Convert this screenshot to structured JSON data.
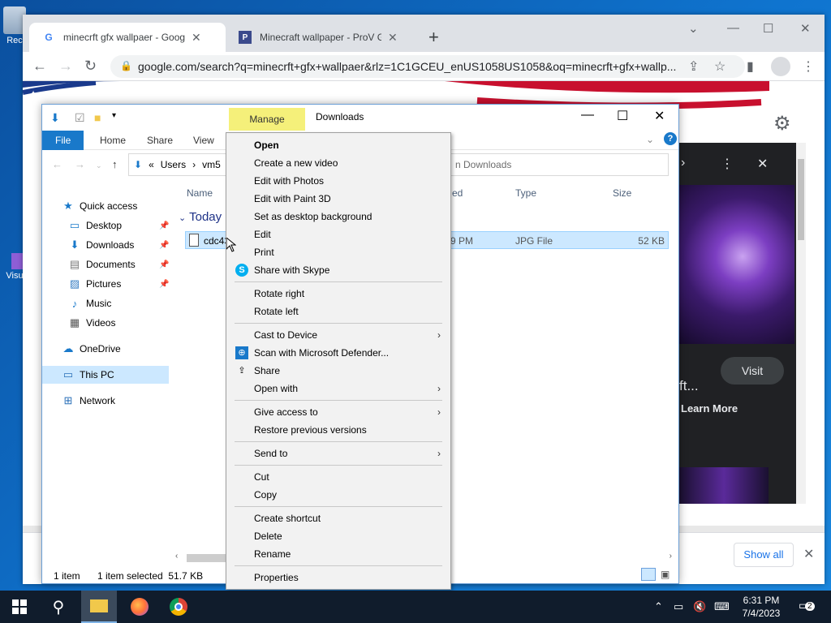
{
  "desktop": {
    "icon1_label": "Rec",
    "icon2_label": "Visu"
  },
  "chrome": {
    "tabs": [
      {
        "title": "minecrft gfx wallpaer - Google Se",
        "favicon": "G"
      },
      {
        "title": "Minecraft wallpaper - ProV GFX -",
        "favicon": "P"
      }
    ],
    "url": "google.com/search?q=minecrft+gfx+wallpaer&rlz=1C1GCEU_enUS1058US1058&oq=minecrft+gfx+wallp...",
    "panel": {
      "title_fragment": "ft...",
      "visit": "Visit",
      "learn_more": "Learn More"
    },
    "download_bar": {
      "show_all": "Show all"
    }
  },
  "explorer": {
    "manage_tab": "Manage",
    "title": "Downloads",
    "ribbon": [
      "File",
      "Home",
      "Share",
      "View"
    ],
    "address": {
      "chevron": "«",
      "segments": [
        "Users",
        "vm5"
      ]
    },
    "search_placeholder": "Search Downloads",
    "search_visible": "n Downloads",
    "nav": [
      {
        "label": "Quick access"
      },
      {
        "label": "Desktop"
      },
      {
        "label": "Downloads"
      },
      {
        "label": "Documents"
      },
      {
        "label": "Pictures"
      },
      {
        "label": "Music"
      },
      {
        "label": "Videos"
      },
      {
        "label": "OneDrive"
      },
      {
        "label": "This PC"
      },
      {
        "label": "Network"
      }
    ],
    "columns": {
      "name": "Name",
      "date": "ed",
      "type": "Type",
      "size": "Size"
    },
    "group": "Today",
    "file": {
      "name": "cdc43",
      "date": "9 PM",
      "type": "JPG File",
      "size": "52 KB"
    },
    "status": {
      "count": "1 item",
      "selected": "1 item selected  51.7 KB"
    }
  },
  "context_menu": {
    "open": "Open",
    "create_video": "Create a new video",
    "edit_photos": "Edit with Photos",
    "edit_paint3d": "Edit with Paint 3D",
    "set_bg": "Set as desktop background",
    "edit": "Edit",
    "print": "Print",
    "share_skype": "Share with Skype",
    "rotate_right": "Rotate right",
    "rotate_left": "Rotate left",
    "cast": "Cast to Device",
    "defender": "Scan with Microsoft Defender...",
    "share": "Share",
    "open_with": "Open with",
    "give_access": "Give access to",
    "restore": "Restore previous versions",
    "send_to": "Send to",
    "cut": "Cut",
    "copy": "Copy",
    "create_shortcut": "Create shortcut",
    "delete": "Delete",
    "rename": "Rename",
    "properties": "Properties"
  },
  "taskbar": {
    "time": "6:31 PM",
    "date": "7/4/2023",
    "notifications": "2"
  },
  "colors": {
    "accent": "#1979ca",
    "selection": "#cce8ff",
    "manage": "#f5f07a",
    "taskbar": "#101c2c"
  }
}
